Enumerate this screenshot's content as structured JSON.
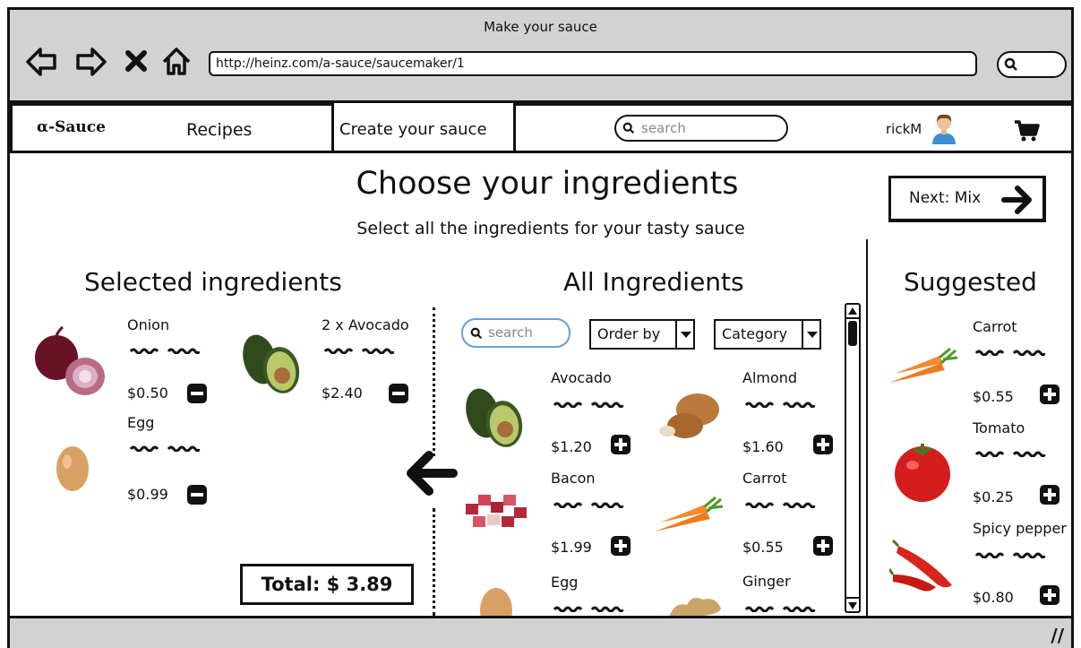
{
  "window": {
    "title": "Make your sauce",
    "url": "http://heinz.com/a-sauce/saucemaker/1"
  },
  "nav": {
    "brand": "α-Sauce",
    "recipes": "Recipes",
    "create": "Create your sauce",
    "search_placeholder": "search",
    "user": "rickM"
  },
  "page": {
    "title": "Choose your ingredients",
    "subtitle": "Select all the ingredients for your tasty sauce",
    "next_label": "Next: Mix"
  },
  "selected": {
    "title": "Selected ingredients",
    "items": [
      {
        "name": "Onion",
        "price": "$0.50"
      },
      {
        "name": "2 x Avocado",
        "price": "$2.40"
      },
      {
        "name": "Egg",
        "price": "$0.99"
      }
    ],
    "total": "Total: $ 3.89"
  },
  "all": {
    "title": "All Ingredients",
    "search_placeholder": "search",
    "order_by": "Order by",
    "category": "Category",
    "items": [
      {
        "name": "Avocado",
        "price": "$1.20"
      },
      {
        "name": "Almond",
        "price": "$1.60"
      },
      {
        "name": "Bacon",
        "price": "$1.99"
      },
      {
        "name": "Carrot",
        "price": "$0.55"
      },
      {
        "name": "Egg",
        "price": ""
      },
      {
        "name": "Ginger",
        "price": ""
      }
    ]
  },
  "suggested": {
    "title": "Suggested",
    "items": [
      {
        "name": "Carrot",
        "price": "$0.55"
      },
      {
        "name": "Tomato",
        "price": "$0.25"
      },
      {
        "name": "Spicy pepper",
        "price": "$0.80"
      }
    ]
  },
  "icons": {
    "back": "back-arrow-icon",
    "forward": "forward-arrow-icon",
    "stop": "close-icon",
    "home": "home-icon",
    "search": "search-icon",
    "user": "user-avatar-icon",
    "cart": "cart-icon",
    "next": "arrow-right-icon",
    "move": "arrow-left-icon",
    "add": "plus-icon",
    "remove": "minus-icon"
  }
}
